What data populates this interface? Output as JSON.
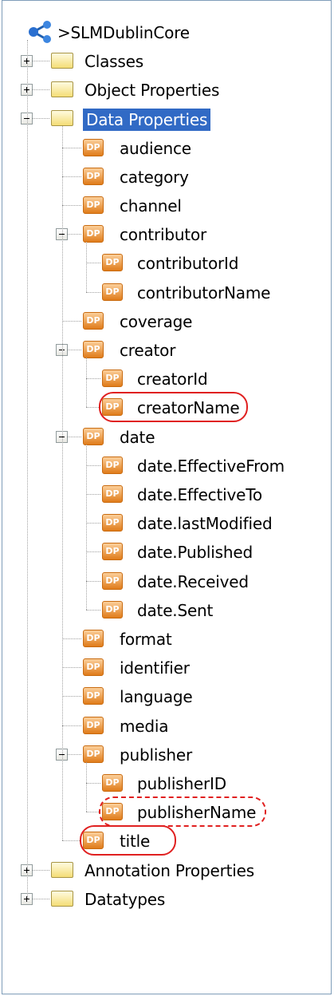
{
  "root": {
    "label": ">SLMDublinCore",
    "icon": "ontology-icon"
  },
  "nodes": [
    {
      "label": "Classes",
      "icon": "folder-icon",
      "level": 1,
      "expander": "plus"
    },
    {
      "label": "Object Properties",
      "icon": "folder-icon",
      "level": 1,
      "expander": "plus"
    },
    {
      "label": "Data Properties",
      "icon": "folder-icon",
      "level": 1,
      "expander": "minus",
      "selected": true
    },
    {
      "label": "audience",
      "icon": "dp-icon",
      "level": 2
    },
    {
      "label": "category",
      "icon": "dp-icon",
      "level": 2
    },
    {
      "label": "channel",
      "icon": "dp-icon",
      "level": 2
    },
    {
      "label": "contributor",
      "icon": "dp-icon",
      "level": 2,
      "expander": "minus"
    },
    {
      "label": "contributorId",
      "icon": "dp-icon",
      "level": 3
    },
    {
      "label": "contributorName",
      "icon": "dp-icon",
      "level": 3
    },
    {
      "label": "coverage",
      "icon": "dp-icon",
      "level": 2
    },
    {
      "label": "creator",
      "icon": "dp-icon",
      "level": 2,
      "expander": "minus"
    },
    {
      "label": "creatorId",
      "icon": "dp-icon",
      "level": 3
    },
    {
      "label": "creatorName",
      "icon": "dp-icon",
      "level": 3,
      "highlight": "solid"
    },
    {
      "label": "date",
      "icon": "dp-icon",
      "level": 2,
      "expander": "minus"
    },
    {
      "label": "date.EffectiveFrom",
      "icon": "dp-icon",
      "level": 3
    },
    {
      "label": "date.EffectiveTo",
      "icon": "dp-icon",
      "level": 3
    },
    {
      "label": "date.lastModified",
      "icon": "dp-icon",
      "level": 3
    },
    {
      "label": "date.Published",
      "icon": "dp-icon",
      "level": 3
    },
    {
      "label": "date.Received",
      "icon": "dp-icon",
      "level": 3
    },
    {
      "label": "date.Sent",
      "icon": "dp-icon",
      "level": 3
    },
    {
      "label": "format",
      "icon": "dp-icon",
      "level": 2
    },
    {
      "label": "identifier",
      "icon": "dp-icon",
      "level": 2
    },
    {
      "label": "language",
      "icon": "dp-icon",
      "level": 2
    },
    {
      "label": "media",
      "icon": "dp-icon",
      "level": 2
    },
    {
      "label": "publisher",
      "icon": "dp-icon",
      "level": 2,
      "expander": "minus"
    },
    {
      "label": "publisherID",
      "icon": "dp-icon",
      "level": 3
    },
    {
      "label": "publisherName",
      "icon": "dp-icon",
      "level": 3,
      "highlight": "dashed"
    },
    {
      "label": "title",
      "icon": "dp-icon",
      "level": 2,
      "highlight": "solid"
    },
    {
      "label": "Annotation Properties",
      "icon": "folder-icon",
      "level": 1,
      "expander": "plus"
    },
    {
      "label": "Datatypes",
      "icon": "folder-icon",
      "level": 1,
      "expander": "plus"
    }
  ],
  "dp_icon_text": "DP",
  "colors": {
    "selection": "#316ac5",
    "highlight": "#e02020",
    "dp_icon": "#e07c1a",
    "folder": "#f4dd76"
  }
}
